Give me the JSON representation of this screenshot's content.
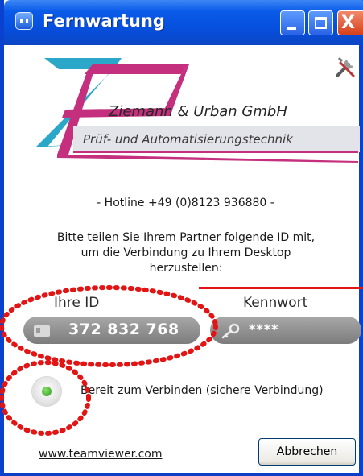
{
  "window": {
    "title": "Fernwartung",
    "close_glyph": "X"
  },
  "branding": {
    "company_name": "Ziemann & Urban GmbH",
    "company_subtitle": "Prüf- und Automatisierungstechnik",
    "logo_colors": {
      "cyan": "#2aa7c9",
      "magenta": "#c4307d"
    }
  },
  "hotline": "- Hotline +49 (0)8123 936880 -",
  "instructions": [
    "Bitte teilen Sie Ihrem Partner folgende ID mit,",
    "um die Verbindung zu Ihrem Desktop",
    "herzustellen:"
  ],
  "id_section": {
    "label": "Ihre ID",
    "value": "372 832 768"
  },
  "password_section": {
    "label": "Kennwort",
    "value": "****"
  },
  "status": {
    "text": "Bereit zum Verbinden (sichere Verbindung)",
    "indicator_color": "#2b9a1d"
  },
  "footer": {
    "link": "www.teamviewer.com",
    "cancel_button": "Abbrechen"
  },
  "colors": {
    "titlebar": "#0650df",
    "accent_red": "#e31414",
    "pill": "#8c8c8c"
  }
}
